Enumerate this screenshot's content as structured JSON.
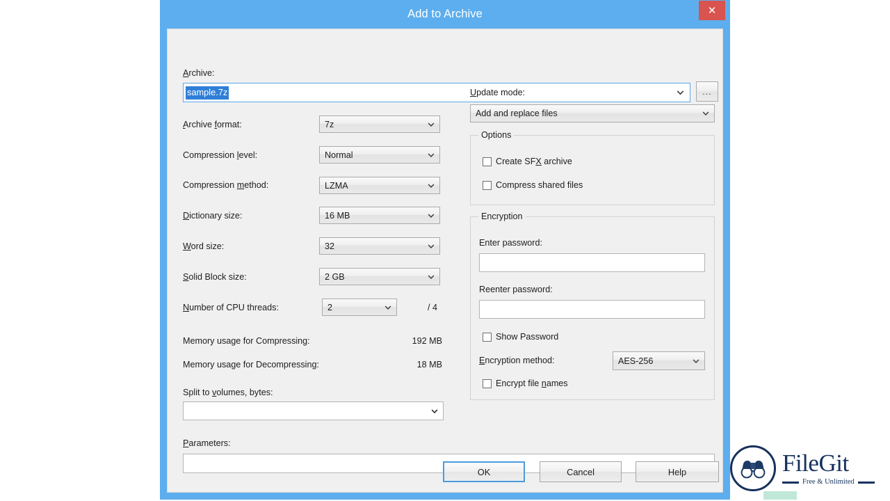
{
  "window": {
    "title": "Add to Archive",
    "close_label": "✕",
    "titlebar_color": "#5caeee",
    "close_color": "#d9534f"
  },
  "archive": {
    "label": "Archive:",
    "label_accel": "A",
    "value": "sample.7z",
    "browse_label": "...",
    "selected": true
  },
  "left_fields": [
    {
      "label": "Archive format:",
      "accel_index": 8,
      "value": "7z",
      "name": "archive-format"
    },
    {
      "label": "Compression level:",
      "accel_index": 12,
      "value": "Normal",
      "name": "compression-level"
    },
    {
      "label": "Compression method:",
      "accel_index": 12,
      "value": "LZMA",
      "name": "compression-method"
    },
    {
      "label": "Dictionary size:",
      "accel_index": 0,
      "value": "16 MB",
      "name": "dictionary-size"
    },
    {
      "label": "Word size:",
      "accel_index": 0,
      "value": "32",
      "name": "word-size"
    },
    {
      "label": "Solid Block size:",
      "accel_index": 0,
      "value": "2 GB",
      "name": "solid-block-size"
    },
    {
      "label": "Number of CPU threads:",
      "accel_index": 0,
      "value": "2",
      "name": "cpu-threads"
    }
  ],
  "cpu_threads_total": "/ 4",
  "memory": {
    "compress_label": "Memory usage for Compressing:",
    "compress_value": "192 MB",
    "decompress_label": "Memory usage for Decompressing:",
    "decompress_value": "18 MB"
  },
  "split": {
    "label": "Split to volumes, bytes:",
    "value": ""
  },
  "parameters": {
    "label": "Parameters:",
    "value": ""
  },
  "update_mode": {
    "label": "Update mode:",
    "value": "Add and replace files"
  },
  "options": {
    "title": "Options",
    "items": [
      {
        "label": "Create SFX archive",
        "checked": false,
        "name": "create-sfx-archive"
      },
      {
        "label": "Compress shared files",
        "checked": false,
        "name": "compress-shared-files"
      }
    ]
  },
  "encryption": {
    "title": "Encryption",
    "enter_password_label": "Enter password:",
    "enter_password_value": "",
    "reenter_password_label": "Reenter password:",
    "reenter_password_value": "",
    "show_password_label": "Show Password",
    "show_password_checked": false,
    "method_label": "Encryption method:",
    "method_value": "AES-256",
    "encrypt_names_label": "Encrypt file names",
    "encrypt_names_checked": false
  },
  "buttons": {
    "ok": "OK",
    "cancel": "Cancel",
    "help": "Help"
  },
  "watermark": {
    "name": "FileGit",
    "tagline": "Free & Unlimited",
    "icon": "binoculars-icon",
    "color": "#16315c"
  }
}
